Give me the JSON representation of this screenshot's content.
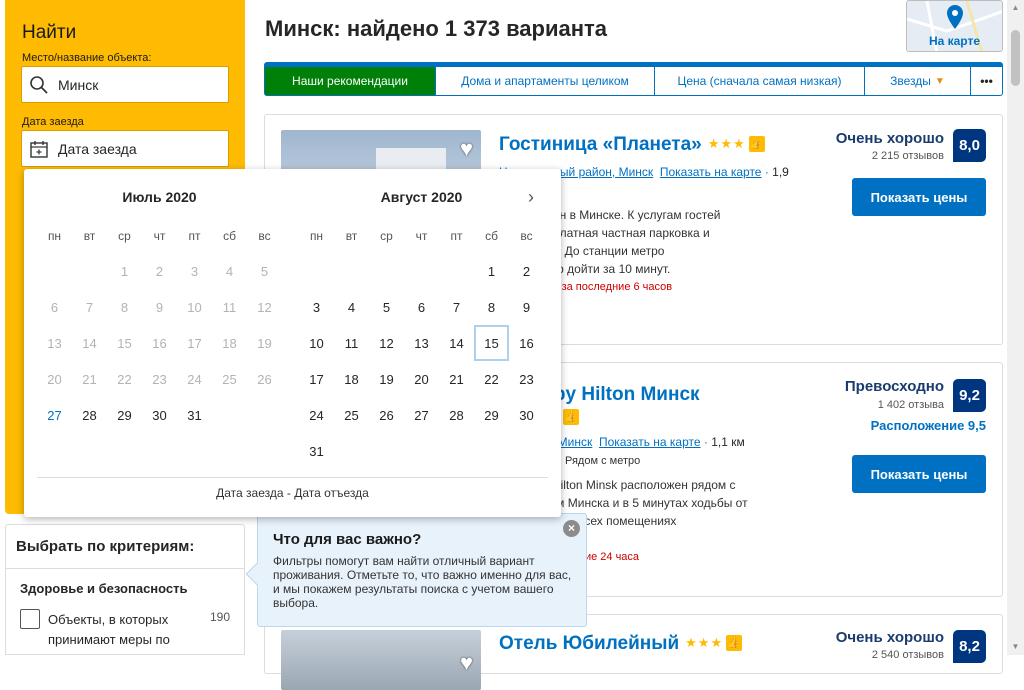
{
  "search": {
    "title": "Найти",
    "place_label": "Место/название объекта:",
    "place_value": "Минск",
    "checkin_label": "Дата заезда",
    "checkin_value": "Дата заезда"
  },
  "results_title": "Минск: найдено 1 373 варианта",
  "map_button_label": "На карте",
  "sort_tabs": [
    {
      "label": "Наши рекомендации",
      "active": true
    },
    {
      "label": "Дома и апартаменты целиком",
      "active": false
    },
    {
      "label": "Цена (сначала самая низкая)",
      "active": false
    },
    {
      "label": "Звезды",
      "active": false
    },
    {
      "label": "•••",
      "active": false
    }
  ],
  "hotels": [
    {
      "name": "Гостиница «Планета»",
      "stars": "★★★",
      "location_prefix": "Ц",
      "location_partial": "ентральный район, Минск",
      "show_on_map": "Показать на карте",
      "distance": "1,9",
      "subline": "ра",
      "description": "расположен в Минске. К услугам гостей\nWi-Fi, бесплатная частная парковка и\nини-баром. До станции метро\nкая» можно дойти за 10 минут.",
      "booked": "вано 2 раза за последние 6 часов",
      "score_word": "Очень хорошо",
      "reviews": "2 215 отзывов",
      "score": "8,0",
      "price_button": "Показать цены"
    },
    {
      "name": "eTree by Hilton Минск",
      "location_partial": "ый район, Минск",
      "show_on_map": "Показать на карте",
      "distance": "1,1 км",
      "subline": "Рядом с метро",
      "description": "leTree by Hilton Minsk расположен рядом с\nим центром Минска и в 5 минутах ходьбы от\n«Немига». Во всех помещениях\nлатный Wi-Fi.",
      "booked": "6 раз за последние 24 часа",
      "score_word": "Превосходно",
      "reviews": "1 402 отзыва",
      "score": "9,2",
      "location_score": "Расположение 9,5",
      "price_button": "Показать цены"
    },
    {
      "name": "Отель Юбилейный",
      "stars": "★★★",
      "score_word": "Очень хорошо",
      "reviews": "2 540 отзывов",
      "score": "8,2"
    }
  ],
  "criteria": {
    "title": "Выбрать по критериям:",
    "section": "Здоровье и безопасность",
    "option_label": "Объекты, в которых принимают меры по",
    "option_count": "190"
  },
  "tooltip": {
    "title": "Что для вас важно?",
    "body": "Фильтры помогут вам найти отличный вариант проживания. Отметьте то, что важно именно для вас, и мы покажем результаты поиска с учетом вашего выбора.",
    "close": "×"
  },
  "calendar": {
    "weekdays": [
      "пн",
      "вт",
      "ср",
      "чт",
      "пт",
      "сб",
      "вс"
    ],
    "months": [
      {
        "title": "Июль 2020",
        "offset": 2,
        "days": 31,
        "past_until": 26,
        "today": 27
      },
      {
        "title": "Август 2020",
        "offset": 5,
        "days": 31,
        "past_until": 0,
        "selected": 15
      }
    ],
    "next_icon": "›",
    "footer": "Дата заезда - Дата отъезда"
  }
}
